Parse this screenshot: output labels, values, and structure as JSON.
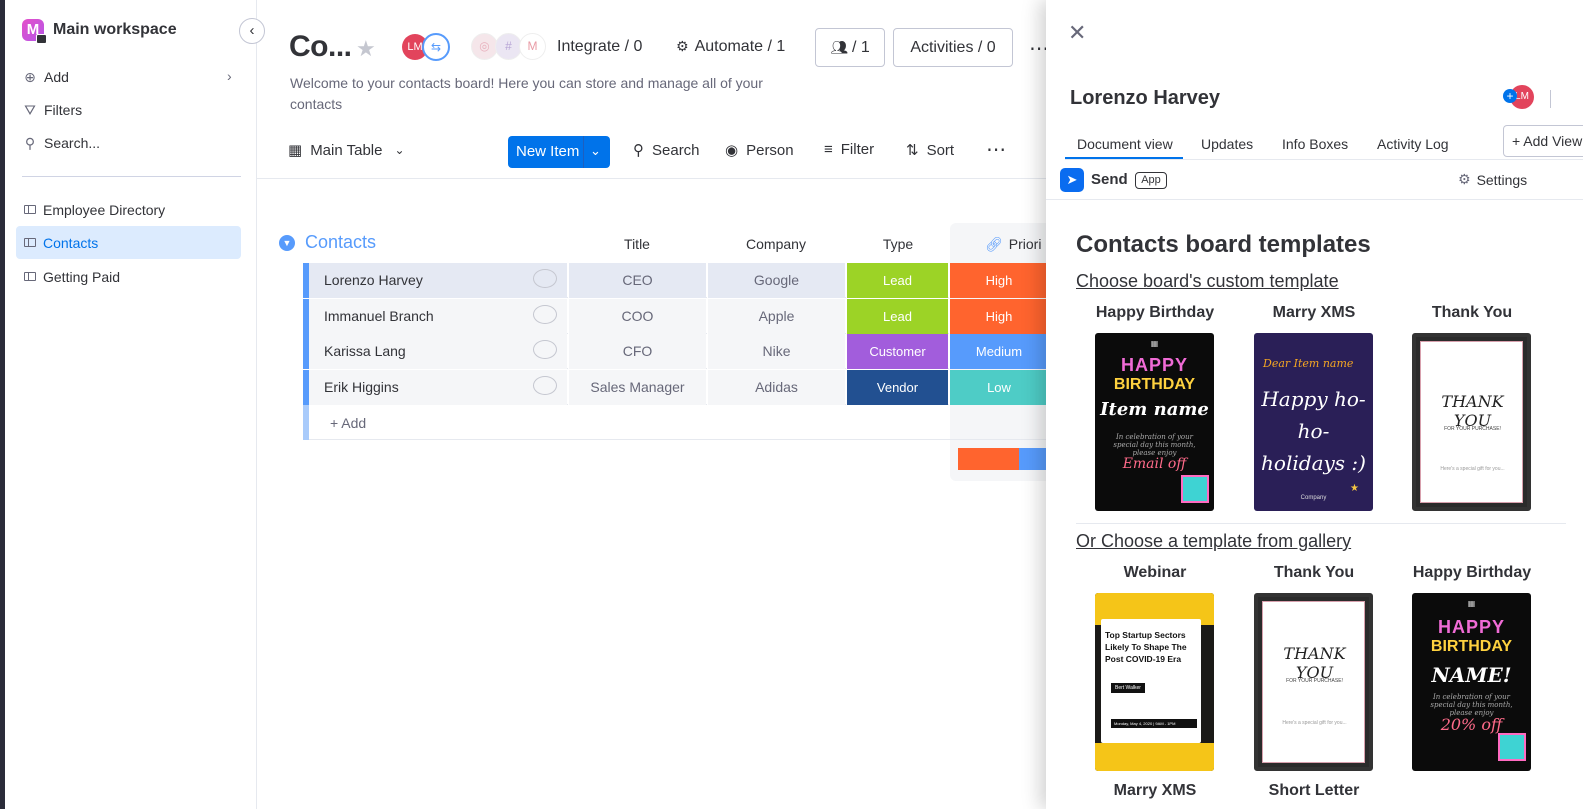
{
  "sidebar": {
    "workspace_title": "Main workspace",
    "workspace_initial": "M",
    "add_label": "Add",
    "filters_label": "Filters",
    "search_label": "Search...",
    "boards": [
      {
        "label": "Employee Directory",
        "active": false
      },
      {
        "label": "Contacts",
        "active": true
      },
      {
        "label": "Getting Paid",
        "active": false
      }
    ]
  },
  "header": {
    "board_title": "Co...",
    "avatar_initials": "LM",
    "integrate_label": "Integrate / 0",
    "automate_label": "Automate / 1",
    "members_label": "/ 1",
    "activities_label": "Activities / 0",
    "description": "Welcome to your contacts board! Here you can store and manage all of your contacts"
  },
  "toolbar": {
    "view_label": "Main Table",
    "new_item_label": "New Item",
    "search_label": "Search",
    "person_label": "Person",
    "filter_label": "Filter",
    "sort_label": "Sort"
  },
  "table": {
    "group_title": "Contacts",
    "columns": {
      "title": "Title",
      "company": "Company",
      "type": "Type",
      "priority": "Priori"
    },
    "rows": [
      {
        "name": "Lorenzo Harvey",
        "title": "CEO",
        "company": "Google",
        "type": "Lead",
        "priority": "High"
      },
      {
        "name": "Immanuel Branch",
        "title": "COO",
        "company": "Apple",
        "type": "Lead",
        "priority": "High"
      },
      {
        "name": "Karissa Lang",
        "title": "CFO",
        "company": "Nike",
        "type": "Customer",
        "priority": "Medium"
      },
      {
        "name": "Erik Higgins",
        "title": "Sales Manager",
        "company": "Adidas",
        "type": "Vendor",
        "priority": "Low"
      }
    ],
    "add_label": "+ Add"
  },
  "colors": {
    "lead": "#9cd326",
    "customer": "#a25ddc",
    "vendor": "#225091",
    "high": "#ff642e",
    "medium": "#579bfc",
    "low": "#4eccc6",
    "primary": "#0073ea"
  },
  "panel": {
    "item_name": "Lorenzo Harvey",
    "avatar_initials": "LM",
    "tabs": [
      "Document view",
      "Updates",
      "Info Boxes",
      "Activity Log"
    ],
    "add_view_label": "+ Add View",
    "app_name": "Send",
    "app_badge": "App",
    "settings_label": "Settings",
    "heading": "Contacts board templates",
    "custom_link": "Choose board's custom template",
    "gallery_link": "Or Choose a template from gallery",
    "custom_templates": [
      "Happy Birthday",
      "Marry XMS",
      "Thank You"
    ],
    "gallery_templates": [
      "Webinar",
      "Thank You",
      "Happy Birthday",
      "Marry XMS",
      "Short Letter"
    ]
  },
  "cards": {
    "bday_happy": "HAPPY",
    "bday_birthday": "BIRTHDAY",
    "bday_name": "Item name",
    "bday_name2": "NAME!",
    "bday_blurb": "In celebration of your special day this month, please enjoy",
    "bday_offer": "Email off",
    "bday_offer2": "20% off",
    "xmas_dear": "Dear Item name",
    "xmas_main": "Happy ho-ho-holidays :)",
    "xmas_company": "Company",
    "thanks_main": "THANK YOU",
    "thanks_sub": "FOR YOUR PURCHASE!",
    "thanks_gift": "Here's a special gift for you...",
    "web_title": "Top Startup Sectors Likely To Shape The Post COVID-19 Era",
    "web_speaker": "Bert Walker",
    "web_date": "Monday, May 4, 2020 | 9AM - 1PM"
  }
}
